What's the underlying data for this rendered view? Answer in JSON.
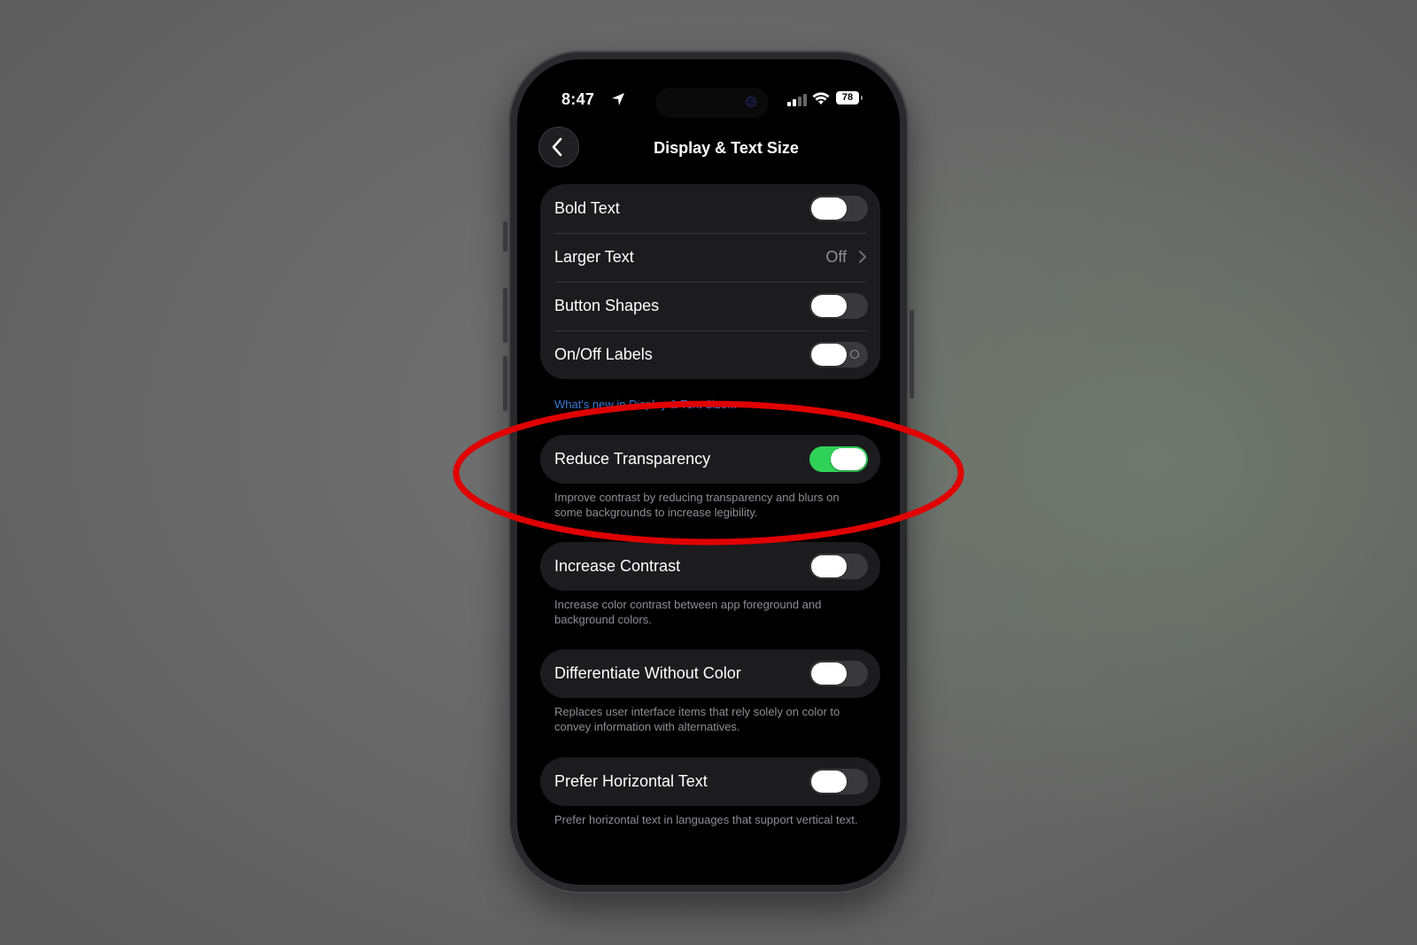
{
  "status_bar": {
    "time": "8:47",
    "battery": "78"
  },
  "nav": {
    "title": "Display & Text Size"
  },
  "group1": {
    "bold_text": {
      "label": "Bold Text",
      "state": "off"
    },
    "larger_text": {
      "label": "Larger Text",
      "value": "Off"
    },
    "button_shapes": {
      "label": "Button Shapes",
      "state": "off"
    },
    "onoff_labels": {
      "label": "On/Off Labels",
      "state": "off"
    }
  },
  "whats_new_link": "What's new in Display & Text Size...",
  "reduce_transparency": {
    "label": "Reduce Transparency",
    "state": "on",
    "footer": "Improve contrast by reducing transparency and blurs on some backgrounds to increase legibility."
  },
  "increase_contrast": {
    "label": "Increase Contrast",
    "state": "off",
    "footer": "Increase color contrast between app foreground and background colors."
  },
  "differentiate_without_color": {
    "label": "Differentiate Without Color",
    "state": "off",
    "footer": "Replaces user interface items that rely solely on color to convey information with alternatives."
  },
  "prefer_horizontal_text": {
    "label": "Prefer Horizontal Text",
    "state": "off",
    "footer": "Prefer horizontal text in languages that support vertical text."
  },
  "colors": {
    "accent_green": "#30d158",
    "link_blue": "#3a7bd5",
    "highlight_red": "#e00000"
  }
}
